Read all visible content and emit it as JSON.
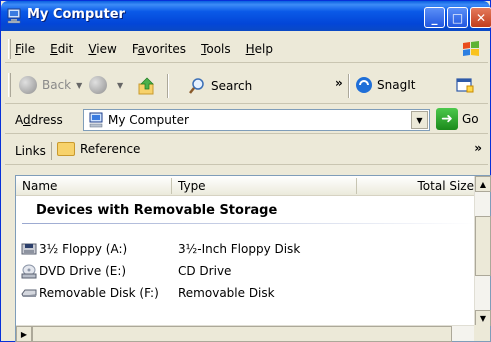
{
  "window": {
    "title": "My Computer",
    "minimize": "_",
    "maximize": "□",
    "close": "✕"
  },
  "menu": {
    "items": [
      {
        "accel": "F",
        "rest": "ile"
      },
      {
        "accel": "E",
        "rest": "dit"
      },
      {
        "accel": "V",
        "rest": "iew"
      },
      {
        "pre": "F",
        "accel": "a",
        "rest": "vorites"
      },
      {
        "accel": "T",
        "rest": "ools"
      },
      {
        "accel": "H",
        "rest": "elp"
      }
    ]
  },
  "toolbar": {
    "back": "Back",
    "search": "Search",
    "more": "»",
    "snagit": "SnagIt"
  },
  "address": {
    "label_pre": "A",
    "label_accel": "d",
    "label_rest": "dress",
    "value": "My Computer",
    "go": "Go"
  },
  "links": {
    "label": "Links",
    "item": "Reference",
    "more": "»"
  },
  "list": {
    "columns": [
      "Name",
      "Type",
      "Total Size"
    ],
    "group": "Devices with Removable Storage",
    "rows": [
      {
        "name": "3½ Floppy (A:)",
        "type": "3½-Inch Floppy Disk",
        "icon": "floppy-drive-icon"
      },
      {
        "name": "DVD Drive (E:)",
        "type": "CD Drive",
        "icon": "dvd-drive-icon"
      },
      {
        "name": "Removable Disk (F:)",
        "type": "Removable Disk",
        "icon": "removable-disk-icon"
      }
    ]
  },
  "colors": {
    "titlebar": "#0a5ae8",
    "face": "#ece9d8",
    "border": "#7f9db9"
  }
}
